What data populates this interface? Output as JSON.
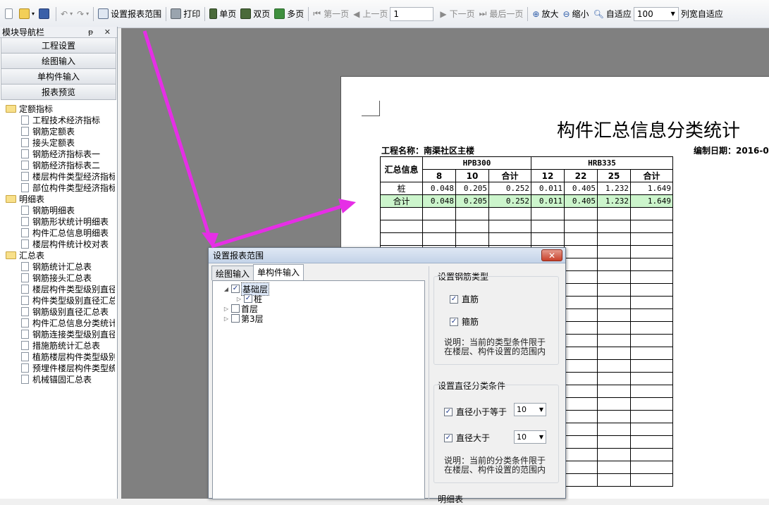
{
  "toolbar": {
    "set_range": "设置报表范围",
    "print": "打印",
    "single_page": "单页",
    "double_page": "双页",
    "multi_page": "多页",
    "first_page": "第一页",
    "prev_page": "上一页",
    "page_value": "1",
    "next_page": "下一页",
    "last_page": "最后一页",
    "zoom_in": "放大",
    "zoom_out": "缩小",
    "fit": "自适应",
    "zoom_value": "100",
    "col_fit": "列宽自适应"
  },
  "nav": {
    "title": "模块导航栏",
    "title_controls": "ᵽ ✕",
    "sections": [
      "工程设置",
      "绘图输入",
      "单构件输入",
      "报表预览"
    ],
    "tree": [
      {
        "folder": "定额指标",
        "items": [
          "工程技术经济指标",
          "钢筋定额表",
          "接头定额表",
          "钢筋经济指标表一",
          "钢筋经济指标表二",
          "楼层构件类型经济指标",
          "部位构件类型经济指标"
        ]
      },
      {
        "folder": "明细表",
        "items": [
          "钢筋明细表",
          "钢筋形状统计明细表",
          "构件汇总信息明细表",
          "楼层构件统计校对表"
        ]
      },
      {
        "folder": "汇总表",
        "items": [
          "钢筋统计汇总表",
          "钢筋接头汇总表",
          "楼层构件类型级别直径",
          "构件类型级别直径汇总",
          "钢筋级别直径汇总表",
          "构件汇总信息分类统计",
          "钢筋连接类型级别直径",
          "措施筋统计汇总表",
          "植筋楼层构件类型级别",
          "预埋件楼层构件类型统",
          "机械锚固汇总表"
        ]
      }
    ]
  },
  "report": {
    "title": "构件汇总信息分类统计",
    "project_label": "工程名称：南渠社区主楼",
    "date_label": "编制日期：2016-0",
    "head_summary": "汇总信息",
    "group1": "HPB300",
    "group2": "HRB335",
    "sub1": [
      "8",
      "10",
      "合计"
    ],
    "sub2": [
      "12",
      "22",
      "25",
      "合计"
    ],
    "rows": [
      {
        "name": "桩",
        "values": [
          "0.048",
          "0.205",
          "0.252",
          "0.011",
          "0.405",
          "1.232",
          "1.649"
        ]
      },
      {
        "name": "合计",
        "values": [
          "0.048",
          "0.205",
          "0.252",
          "0.011",
          "0.405",
          "1.232",
          "1.649"
        ]
      }
    ]
  },
  "dialog": {
    "title": "设置报表范围",
    "close": "✕",
    "tabs": [
      "绘图输入",
      "单构件输入"
    ],
    "tree": {
      "root": "基础层",
      "child": "桩",
      "floor1": "首层",
      "floor3": "第3层"
    },
    "steel_group": {
      "title": "设置钢筋类型",
      "opt1": "直筋",
      "opt2": "箍筋",
      "note": "说明：当前的类型条件限于在楼层、构件设置的范围内"
    },
    "diam_group": {
      "title": "设置直径分类条件",
      "opt1": "直径小于等于",
      "val1": "10",
      "opt2": "直径大于",
      "val2": "10",
      "note": "说明：当前的分类条件限于在楼层、构件设置的范围内"
    },
    "detail_group": {
      "title": "明细表"
    }
  },
  "colors": {
    "arrow": "#e62ee6",
    "sum_row": "#ccf5cc",
    "preview_bg": "#808080"
  }
}
